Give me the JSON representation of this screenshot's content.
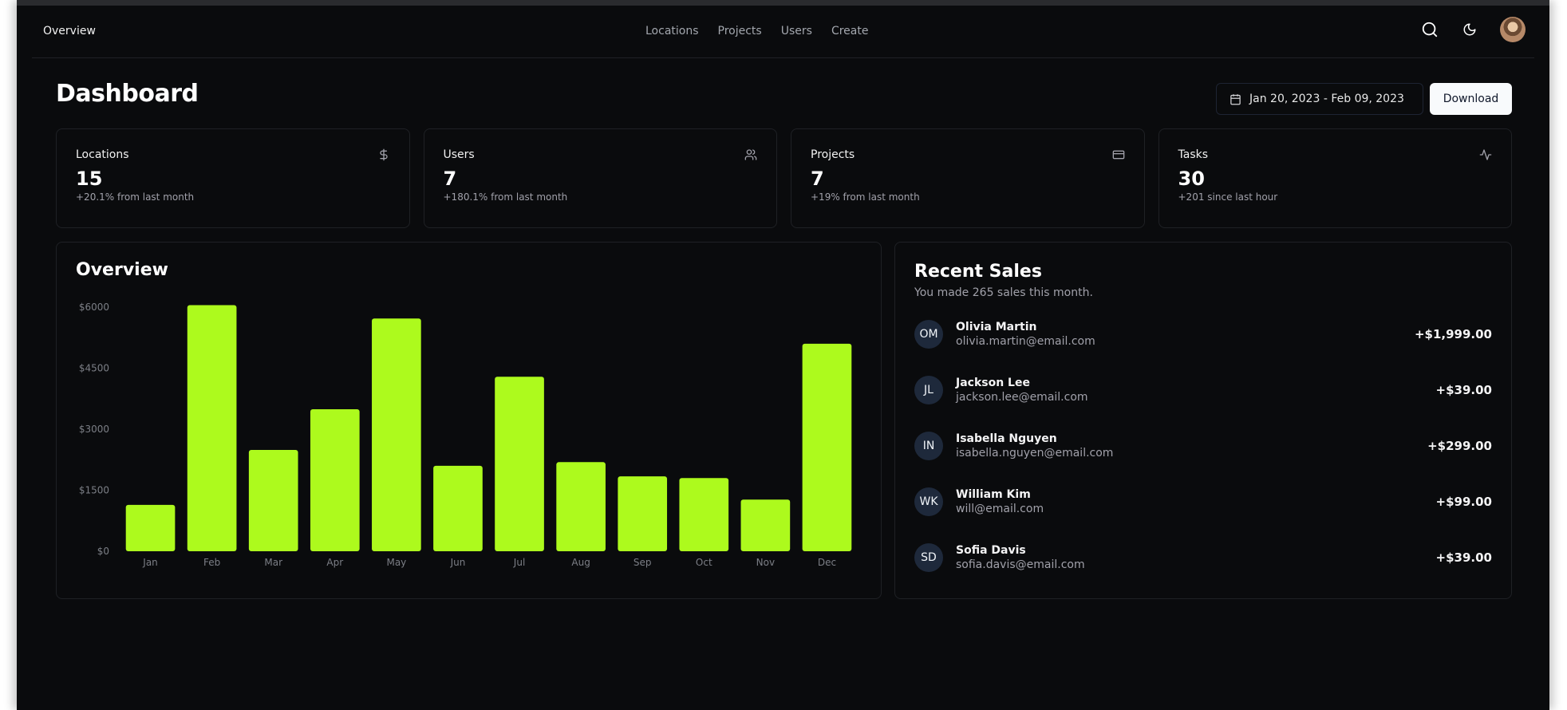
{
  "nav": {
    "brand": "Overview",
    "links": [
      "Locations",
      "Projects",
      "Users",
      "Create"
    ],
    "icons": [
      "search-icon",
      "moon-icon",
      "user-avatar"
    ]
  },
  "header": {
    "title": "Dashboard",
    "date_range": "Jan 20, 2023 - Feb 09, 2023",
    "download_label": "Download"
  },
  "cards": [
    {
      "title": "Locations",
      "value": "15",
      "sub": "+20.1% from last month",
      "icon": "dollar-icon"
    },
    {
      "title": "Users",
      "value": "7",
      "sub": "+180.1% from last month",
      "icon": "users-icon"
    },
    {
      "title": "Projects",
      "value": "7",
      "sub": "+19% from last month",
      "icon": "credit-card-icon"
    },
    {
      "title": "Tasks",
      "value": "30",
      "sub": "+201 since last hour",
      "icon": "activity-icon"
    }
  ],
  "chart_data": {
    "type": "bar",
    "title": "Overview",
    "categories": [
      "Jan",
      "Feb",
      "Mar",
      "Apr",
      "May",
      "Jun",
      "Jul",
      "Aug",
      "Sep",
      "Oct",
      "Nov",
      "Dec"
    ],
    "values": [
      1140,
      6050,
      2490,
      3490,
      5720,
      2100,
      4290,
      2190,
      1840,
      1800,
      1270,
      5100
    ],
    "yticks": [
      0,
      1500,
      3000,
      4500,
      6000
    ],
    "ytick_labels": [
      "$0",
      "$1500",
      "$3000",
      "$4500",
      "$6000"
    ],
    "ylim": [
      0,
      6000
    ],
    "xlabel": "",
    "ylabel": "",
    "grid": false,
    "bar_color": "#adfa1d"
  },
  "sales": {
    "title": "Recent Sales",
    "subtitle": "You made 265 sales this month.",
    "items": [
      {
        "initials": "OM",
        "name": "Olivia Martin",
        "email": "olivia.martin@email.com",
        "amount": "+$1,999.00"
      },
      {
        "initials": "JL",
        "name": "Jackson Lee",
        "email": "jackson.lee@email.com",
        "amount": "+$39.00"
      },
      {
        "initials": "IN",
        "name": "Isabella Nguyen",
        "email": "isabella.nguyen@email.com",
        "amount": "+$299.00"
      },
      {
        "initials": "WK",
        "name": "William Kim",
        "email": "will@email.com",
        "amount": "+$99.00"
      },
      {
        "initials": "SD",
        "name": "Sofia Davis",
        "email": "sofia.davis@email.com",
        "amount": "+$39.00"
      }
    ]
  }
}
